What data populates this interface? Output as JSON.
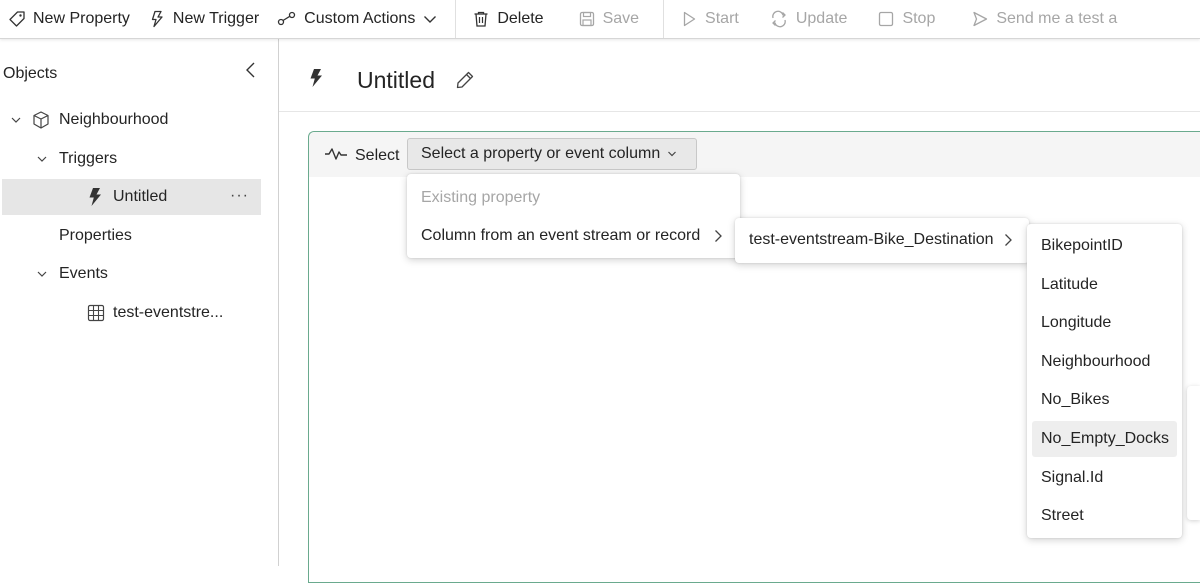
{
  "toolbar": {
    "new_property": "New Property",
    "new_trigger": "New Trigger",
    "custom_actions": "Custom Actions",
    "delete": "Delete",
    "save": "Save",
    "start": "Start",
    "update": "Update",
    "stop": "Stop",
    "send_test": "Send me a test a"
  },
  "sidebar": {
    "header": "Objects",
    "object_name": "Neighbourhood",
    "triggers_label": "Triggers",
    "trigger_item": "Untitled",
    "properties_label": "Properties",
    "events_label": "Events",
    "event_item": "test-eventstre..."
  },
  "main": {
    "title": "Untitled",
    "select_label": "Select",
    "select_dropdown": "Select a property or event column"
  },
  "menu1": {
    "existing_property": "Existing property",
    "column_from_stream": "Column from an event stream or record"
  },
  "menu2": {
    "stream": "test-eventstream-Bike_Destination"
  },
  "menu3": {
    "columns": [
      "BikepointID",
      "Latitude",
      "Longitude",
      "Neighbourhood",
      "No_Bikes",
      "No_Empty_Docks",
      "Signal.Id",
      "Street"
    ],
    "hovered": "No_Empty_Docks"
  },
  "colors": {
    "card_border": "#6aaa8e",
    "selected_bg": "#e6e6e6",
    "disabled_text": "#a6a6a6"
  },
  "icons": {
    "new_property": "tag-icon",
    "new_trigger": "bolt-outline-icon",
    "custom_actions": "flow-icon",
    "delete": "trash-icon",
    "save": "save-icon",
    "start": "play-icon",
    "update": "refresh-icon",
    "stop": "stop-icon",
    "send_test": "send-icon"
  }
}
